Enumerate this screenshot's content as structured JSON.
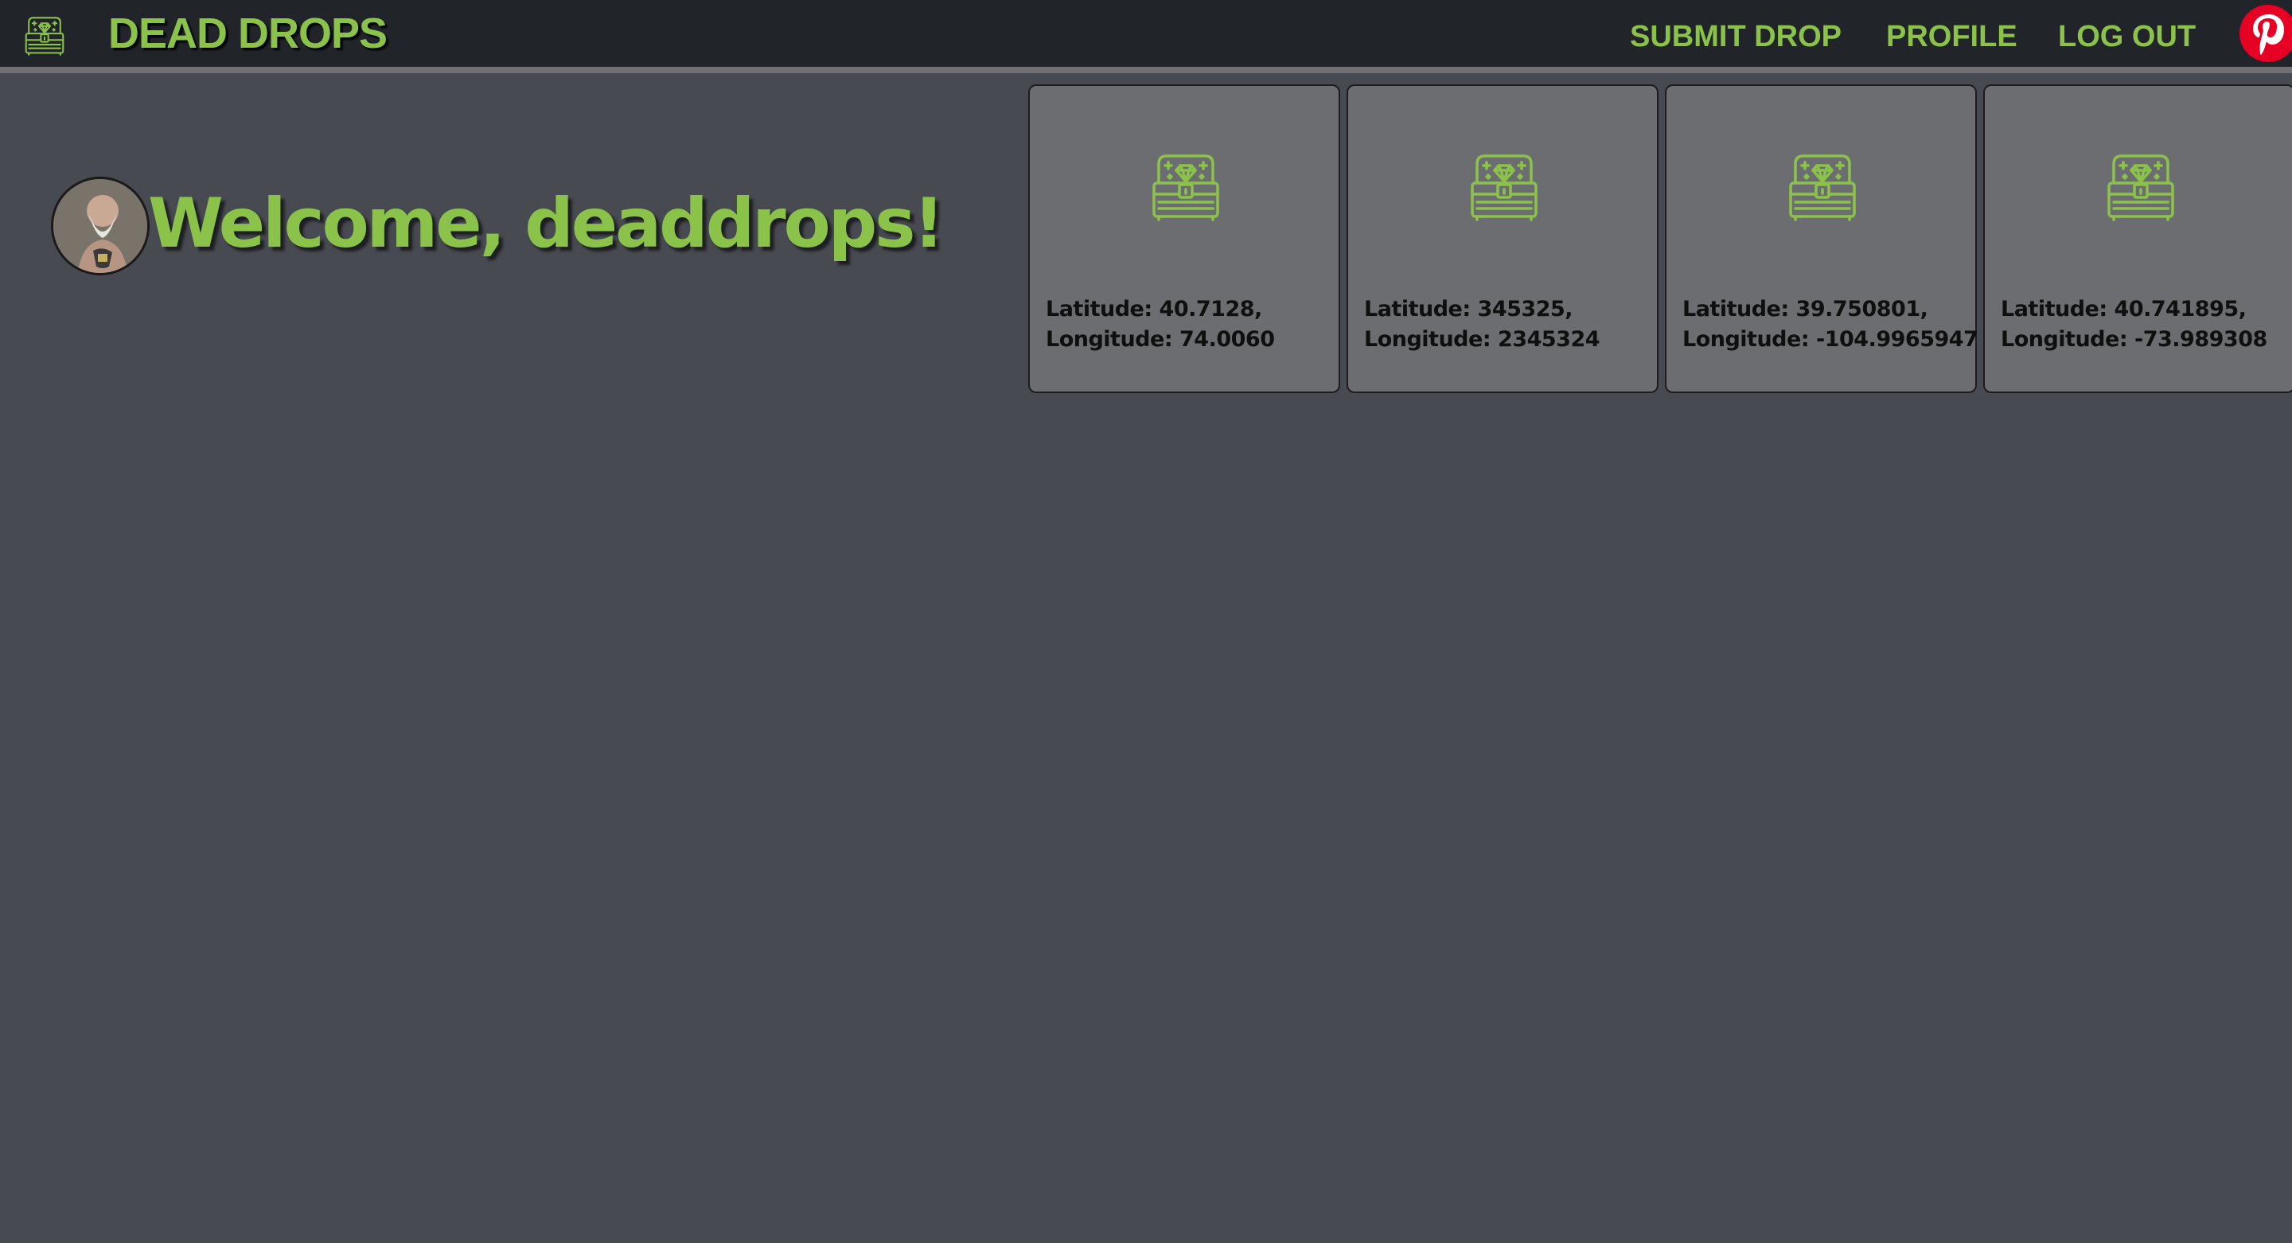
{
  "navbar": {
    "logo_icon": "treasure-chest-icon",
    "brand": "DEAD DROPS",
    "links": [
      "SUBMIT DROP",
      "PROFILE",
      "LOG OUT"
    ],
    "social_icon": "pinterest-icon"
  },
  "welcome": {
    "avatar": "user-avatar",
    "title": "Welcome, deaddrops!"
  },
  "drops": [
    {
      "icon": "treasure-chest-icon",
      "latitude": "Latitude: 40.7128,",
      "longitude": "Longitude: 74.0060"
    },
    {
      "icon": "treasure-chest-icon",
      "latitude": "Latitude: 345325,",
      "longitude": "Longitude: 2345324"
    },
    {
      "icon": "treasure-chest-icon",
      "latitude": "Latitude: 39.750801,",
      "longitude": "Longitude: -104.9965947"
    },
    {
      "icon": "treasure-chest-icon",
      "latitude": "Latitude: 40.741895,",
      "longitude": "Longitude: -73.989308"
    }
  ],
  "colors": {
    "accent": "#8bc34a",
    "navbar_bg": "#212529",
    "page_bg": "#474a50",
    "card_bg": "#6c6d70",
    "pinterest": "#e60023"
  }
}
